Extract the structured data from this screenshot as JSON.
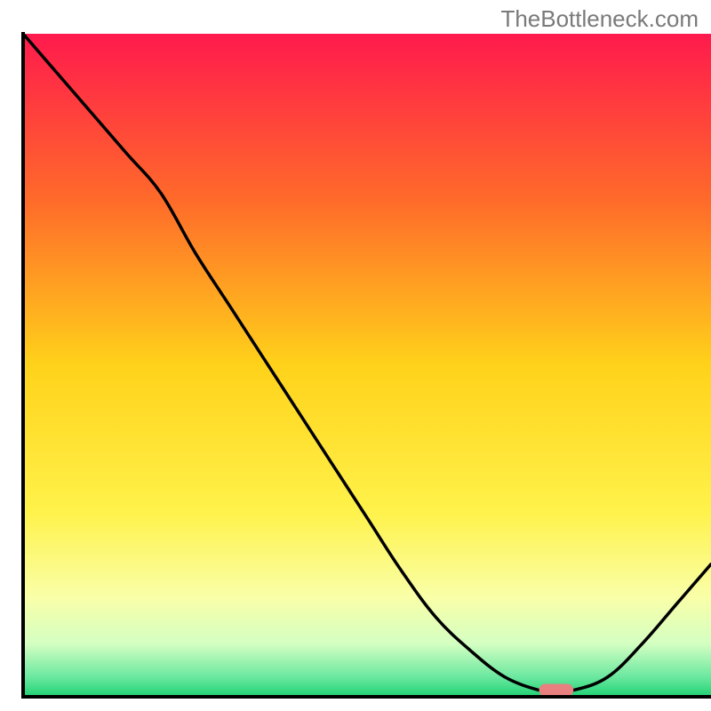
{
  "watermark": "TheBottleneck.com",
  "chart_data": {
    "type": "line",
    "title": "",
    "xlabel": "",
    "ylabel": "",
    "xlim": [
      0,
      100
    ],
    "ylim": [
      0,
      100
    ],
    "x": [
      0,
      5,
      10,
      15,
      20,
      25,
      30,
      35,
      40,
      45,
      50,
      55,
      60,
      65,
      70,
      75,
      77,
      80,
      85,
      90,
      95,
      100
    ],
    "values": [
      100,
      94,
      88,
      82,
      76,
      67,
      59,
      51,
      43,
      35,
      27,
      19,
      12,
      7,
      3,
      1,
      1,
      1,
      3,
      8,
      14,
      20
    ],
    "marker": {
      "x_start": 75,
      "x_end": 80,
      "y": 1
    },
    "gradient_stops": [
      {
        "offset": 0.0,
        "color": "#ff1a4d"
      },
      {
        "offset": 0.25,
        "color": "#ff6a2a"
      },
      {
        "offset": 0.5,
        "color": "#ffd21a"
      },
      {
        "offset": 0.72,
        "color": "#fff24a"
      },
      {
        "offset": 0.85,
        "color": "#f9ffa8"
      },
      {
        "offset": 0.92,
        "color": "#d4ffc2"
      },
      {
        "offset": 0.97,
        "color": "#6be8a0"
      },
      {
        "offset": 1.0,
        "color": "#1fd172"
      }
    ],
    "axis_color": "#000000",
    "curve_color": "#000000",
    "marker_color": "#e98080"
  }
}
